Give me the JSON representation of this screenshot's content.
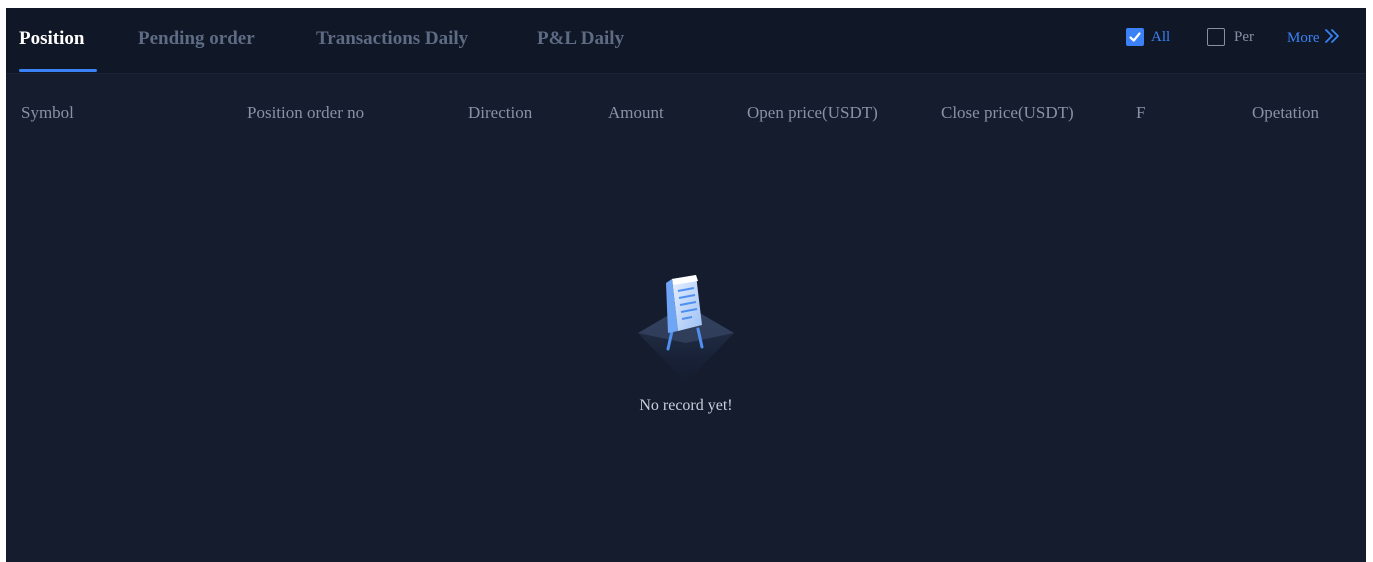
{
  "tabs": [
    {
      "label": "Position",
      "active": true
    },
    {
      "label": "Pending order",
      "active": false
    },
    {
      "label": "Transactions Daily",
      "active": false
    },
    {
      "label": "P&L Daily",
      "active": false
    }
  ],
  "filters": {
    "all": {
      "label": "All",
      "checked": true
    },
    "per": {
      "label": "Per",
      "checked": false
    }
  },
  "more": {
    "label": "More",
    "icon": "double-chevron-right-icon"
  },
  "columns": [
    "Symbol",
    "Position order no",
    "Direction",
    "Amount",
    "Open price(USDT)",
    "Close price(USDT)",
    "F",
    "Opetation"
  ],
  "empty_state": {
    "message": "No record yet!",
    "icon": "clipboard-document-icon"
  },
  "colors": {
    "background": "#141c2d",
    "tabbar": "#101726",
    "accent": "#3b82f6",
    "active_tab": "#ffffff",
    "inactive_tab": "#5e6b84",
    "header_text": "#8892a6"
  }
}
